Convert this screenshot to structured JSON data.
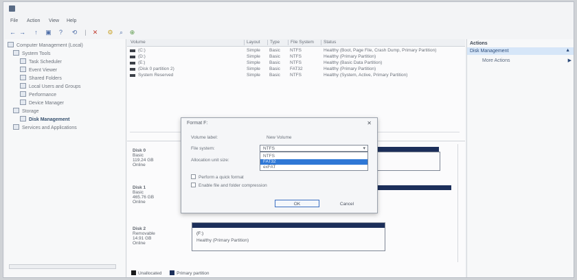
{
  "app": {
    "icon": "computer-management-icon",
    "title": ""
  },
  "menu": {
    "items": [
      "File",
      "Action",
      "View",
      "Help"
    ]
  },
  "toolbar": {
    "buttons": [
      {
        "name": "back-arrow-icon",
        "glyph": "←"
      },
      {
        "name": "forward-arrow-icon",
        "glyph": "→"
      },
      {
        "name": "up-icon",
        "glyph": "↑"
      },
      {
        "name": "properties-icon",
        "glyph": "▣"
      },
      {
        "name": "help-icon",
        "glyph": "?"
      },
      {
        "name": "refresh-icon",
        "glyph": "⟲"
      },
      {
        "name": "separator-icon",
        "glyph": "|"
      },
      {
        "name": "delete-icon",
        "glyph": "✕"
      },
      {
        "name": "settings-icon",
        "glyph": "⚙"
      },
      {
        "name": "search-icon",
        "glyph": "⌕"
      },
      {
        "name": "zoom-icon",
        "glyph": "⊕"
      }
    ]
  },
  "tree": {
    "items": [
      {
        "label": "Computer Management (Local)",
        "level": 0
      },
      {
        "label": "System Tools",
        "level": 1
      },
      {
        "label": "Task Scheduler",
        "level": 2
      },
      {
        "label": "Event Viewer",
        "level": 2
      },
      {
        "label": "Shared Folders",
        "level": 2
      },
      {
        "label": "Local Users and Groups",
        "level": 2
      },
      {
        "label": "Performance",
        "level": 2
      },
      {
        "label": "Device Manager",
        "level": 2
      },
      {
        "label": "Storage",
        "level": 1
      },
      {
        "label": "Disk Management",
        "level": 2,
        "selected": true
      },
      {
        "label": "Services and Applications",
        "level": 1
      }
    ]
  },
  "volumes": {
    "columns": [
      "Volume",
      "Layout",
      "Type",
      "File System",
      "Status"
    ],
    "rows": [
      {
        "volume": "(C:)",
        "layout": "Simple",
        "type": "Basic",
        "fs": "NTFS",
        "status": "Healthy (Boot, Page File, Crash Dump, Primary Partition)"
      },
      {
        "volume": "(D:)",
        "layout": "Simple",
        "type": "Basic",
        "fs": "NTFS",
        "status": "Healthy (Primary Partition)"
      },
      {
        "volume": "(E:)",
        "layout": "Simple",
        "type": "Basic",
        "fs": "NTFS",
        "status": "Healthy (Basic Data Partition)"
      },
      {
        "volume": "(Disk 0 partition 2)",
        "layout": "Simple",
        "type": "Basic",
        "fs": "FAT32",
        "status": "Healthy (Primary Partition)"
      },
      {
        "volume": "System Reserved",
        "layout": "Simple",
        "type": "Basic",
        "fs": "NTFS",
        "status": "Healthy (System, Active, Primary Partition)"
      }
    ]
  },
  "disks": [
    {
      "name": "Disk 0",
      "type": "Basic",
      "size": "119.24 GB",
      "state": "Online"
    },
    {
      "name": "Disk 1",
      "type": "Basic",
      "size": "465.76 GB",
      "state": "Online"
    },
    {
      "name": "Disk 2",
      "type": "Removable",
      "size": "14.91 GB",
      "state": "Online"
    }
  ],
  "disk_partitions": {
    "disk2": {
      "label": "(F:)",
      "status": "Healthy (Primary Partition)"
    }
  },
  "legend": {
    "items": [
      "Unallocated",
      "Primary partition"
    ]
  },
  "actions": {
    "header": "Actions",
    "selected": "Disk Management",
    "more": "More Actions"
  },
  "dialog": {
    "title": "Format F:",
    "fields": [
      {
        "label": "Volume label:",
        "value": "New Volume"
      },
      {
        "label": "File system:",
        "value": "NTFS"
      },
      {
        "label": "Allocation unit size:",
        "value": ""
      }
    ],
    "fs_options": [
      "NTFS",
      "FAT32",
      "exFAT"
    ],
    "fs_selected": "FAT32",
    "checks": [
      {
        "label": "Perform a quick format"
      },
      {
        "label": "Enable file and folder compression"
      }
    ],
    "ok": "OK",
    "cancel": "Cancel"
  }
}
